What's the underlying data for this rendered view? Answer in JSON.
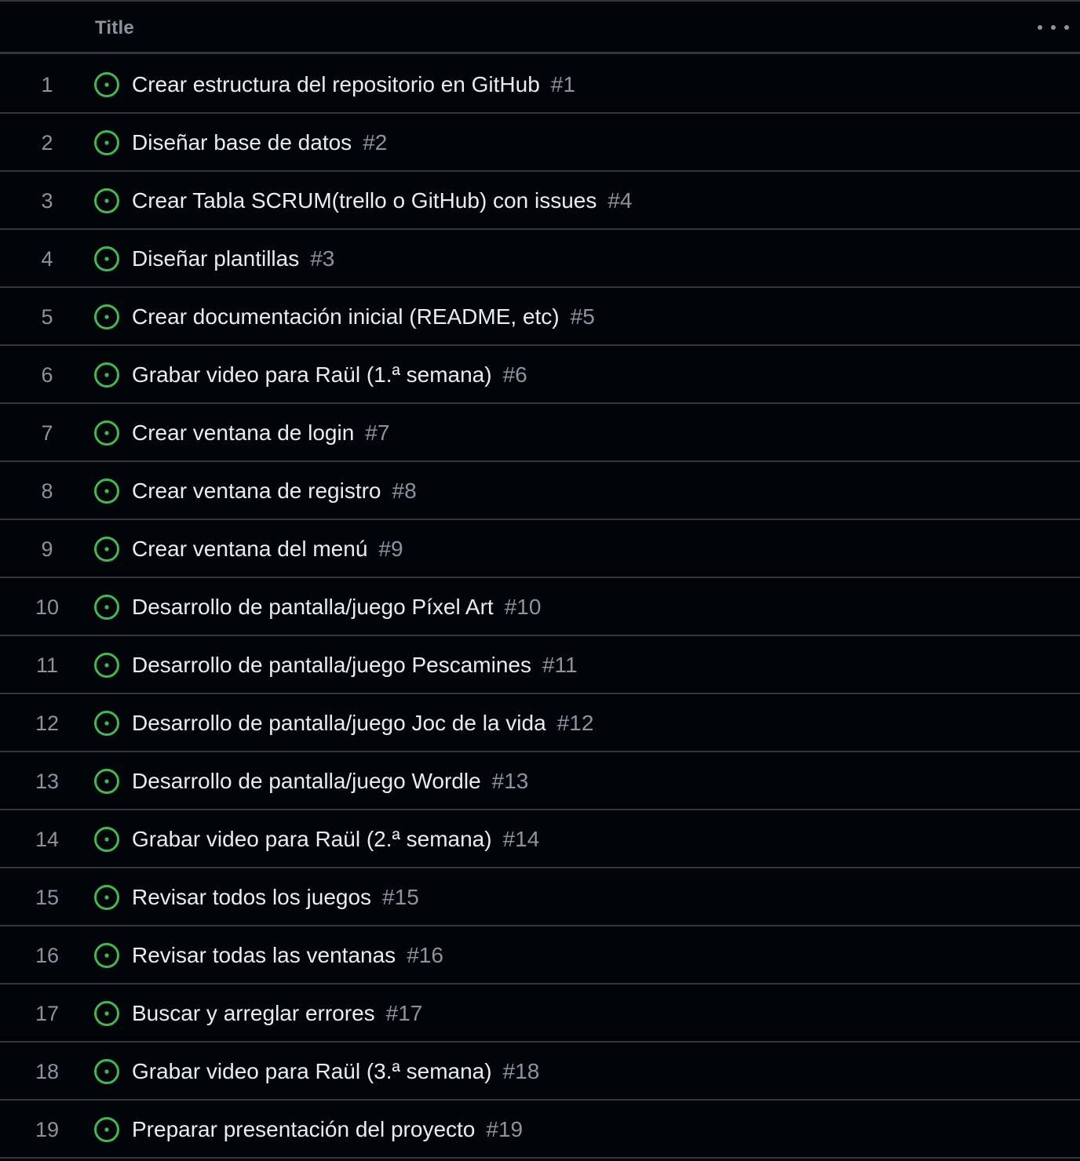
{
  "header": {
    "title_label": "Title",
    "menu_icon": "kebab-horizontal-icon"
  },
  "colors": {
    "background": "#010409",
    "border": "#30363d",
    "open_icon": "#3fb950",
    "muted_text": "#8b949e",
    "primary_text": "#e6edf3"
  },
  "rows": [
    {
      "index": "1",
      "title": "Crear estructura del repositorio en GitHub",
      "number": "#1",
      "status_icon": "issue-opened-icon"
    },
    {
      "index": "2",
      "title": "Diseñar base de datos",
      "number": "#2",
      "status_icon": "issue-opened-icon"
    },
    {
      "index": "3",
      "title": "Crear Tabla SCRUM(trello o GitHub) con issues",
      "number": "#4",
      "status_icon": "issue-opened-icon"
    },
    {
      "index": "4",
      "title": "Diseñar plantillas",
      "number": "#3",
      "status_icon": "issue-opened-icon"
    },
    {
      "index": "5",
      "title": "Crear documentación inicial (README, etc)",
      "number": "#5",
      "status_icon": "issue-opened-icon"
    },
    {
      "index": "6",
      "title": "Grabar video para Raül (1.ª semana)",
      "number": "#6",
      "status_icon": "issue-opened-icon"
    },
    {
      "index": "7",
      "title": "Crear ventana de login",
      "number": "#7",
      "status_icon": "issue-opened-icon"
    },
    {
      "index": "8",
      "title": "Crear ventana de registro",
      "number": "#8",
      "status_icon": "issue-opened-icon"
    },
    {
      "index": "9",
      "title": "Crear ventana del menú",
      "number": "#9",
      "status_icon": "issue-opened-icon"
    },
    {
      "index": "10",
      "title": "Desarrollo de pantalla/juego Píxel Art",
      "number": "#10",
      "status_icon": "issue-opened-icon"
    },
    {
      "index": "11",
      "title": "Desarrollo de pantalla/juego Pescamines",
      "number": "#11",
      "status_icon": "issue-opened-icon"
    },
    {
      "index": "12",
      "title": "Desarrollo de pantalla/juego Joc de la vida",
      "number": "#12",
      "status_icon": "issue-opened-icon"
    },
    {
      "index": "13",
      "title": "Desarrollo de pantalla/juego Wordle",
      "number": "#13",
      "status_icon": "issue-opened-icon"
    },
    {
      "index": "14",
      "title": "Grabar video para Raül (2.ª semana)",
      "number": "#14",
      "status_icon": "issue-opened-icon"
    },
    {
      "index": "15",
      "title": "Revisar todos los juegos",
      "number": "#15",
      "status_icon": "issue-opened-icon"
    },
    {
      "index": "16",
      "title": "Revisar todas las ventanas",
      "number": "#16",
      "status_icon": "issue-opened-icon"
    },
    {
      "index": "17",
      "title": "Buscar y arreglar errores",
      "number": "#17",
      "status_icon": "issue-opened-icon"
    },
    {
      "index": "18",
      "title": "Grabar video para Raül (3.ª semana)",
      "number": "#18",
      "status_icon": "issue-opened-icon"
    },
    {
      "index": "19",
      "title": "Preparar presentación del proyecto",
      "number": "#19",
      "status_icon": "issue-opened-icon"
    }
  ]
}
